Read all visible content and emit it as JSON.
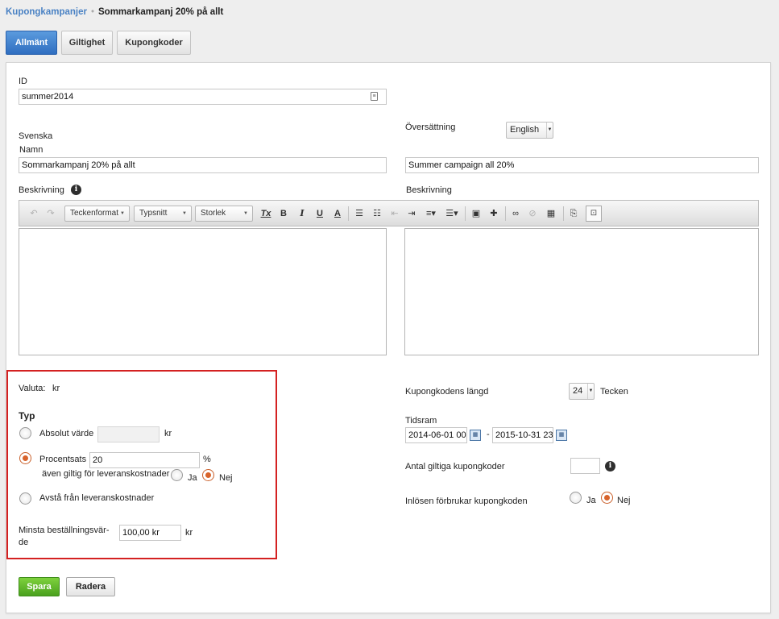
{
  "breadcrumb": {
    "parent": "Kupongkampanjer",
    "separator": "•",
    "current": "Sommarkampanj 20% på allt"
  },
  "tabs": [
    "Allmänt",
    "Giltighet",
    "Kupongkoder"
  ],
  "id_field": {
    "label": "ID",
    "value": "summer2014"
  },
  "left_lang": {
    "label": "Svenska",
    "name_label": "Namn",
    "name_value": "Sommarkampanj 20% på allt",
    "desc_label": "Beskrivning"
  },
  "translation": {
    "label": "Översättning",
    "language": "English",
    "name_value": "Summer campaign all 20%",
    "desc_label": "Beskrivning"
  },
  "toolbar": {
    "format": "Teckenformat",
    "font": "Typsnitt",
    "size": "Storlek",
    "bold": "B",
    "italic": "I",
    "underline": "U",
    "color": "A",
    "clear_format": "Tx"
  },
  "currency": {
    "label": "Valuta:",
    "value": "kr"
  },
  "type": {
    "heading": "Typ",
    "absolute_label": "Absolut värde",
    "absolute_unit": "kr",
    "percent_label": "Procentsats",
    "percent_value": "20",
    "percent_unit": "%",
    "shipping_label": "även giltig för leveranskostnader",
    "yes": "Ja",
    "no": "Nej",
    "free_shipping_label": "Avstå från leveranskostnader"
  },
  "min_order": {
    "label_line1": "Minsta beställningsvär-",
    "label_line2": "de",
    "value": "100,00 kr",
    "unit": "kr"
  },
  "right_settings": {
    "code_length_label": "Kupongkodens längd",
    "code_length_value": "24",
    "code_length_unit": "Tecken",
    "timeframe_label": "Tidsram",
    "date_from": "2014-06-01 00",
    "date_sep": "-",
    "date_to": "2015-10-31 23",
    "valid_codes_label": "Antal giltiga kupongkoder",
    "valid_codes_value": "",
    "redeem_label": "Inlösen förbrukar kupongkoden",
    "yes": "Ja",
    "no": "Nej"
  },
  "actions": {
    "save": "Spara",
    "delete": "Radera"
  },
  "colors": {
    "primary": "#3478c8",
    "save": "#5cb82a",
    "highlight": "#d42121",
    "radio_on": "#d8632b"
  }
}
